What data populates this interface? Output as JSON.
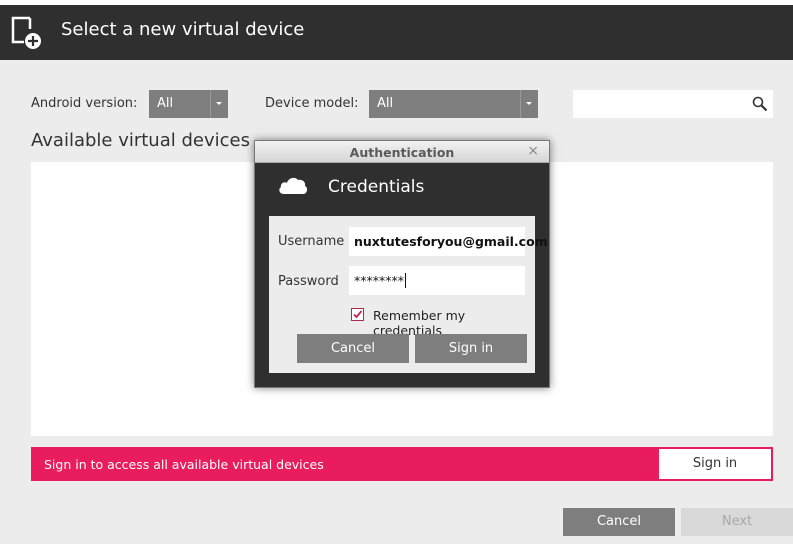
{
  "header": {
    "title": "Select a new virtual device",
    "icon": "add-device-icon"
  },
  "filters": {
    "android_version_label": "Android version:",
    "android_version_value": "All",
    "device_model_label": "Device model:",
    "device_model_value": "All",
    "search_value": ""
  },
  "list": {
    "title": "Available virtual devices"
  },
  "banner": {
    "text": "Sign in to access all available virtual devices",
    "sign_in_label": "Sign in",
    "color": "#e91c5d"
  },
  "footer": {
    "cancel_label": "Cancel",
    "next_label": "Next"
  },
  "dialog": {
    "window_title": "Authentication",
    "close_glyph": "×",
    "heading": "Credentials",
    "heading_icon": "cloud-icon",
    "username_label": "Username",
    "username_value": "nuxtutesforyou@gmail.com",
    "password_label": "Password",
    "password_value": "********",
    "remember_label": "Remember my credentials",
    "remember_checked": true,
    "cancel_label": "Cancel",
    "sign_in_label": "Sign in"
  }
}
